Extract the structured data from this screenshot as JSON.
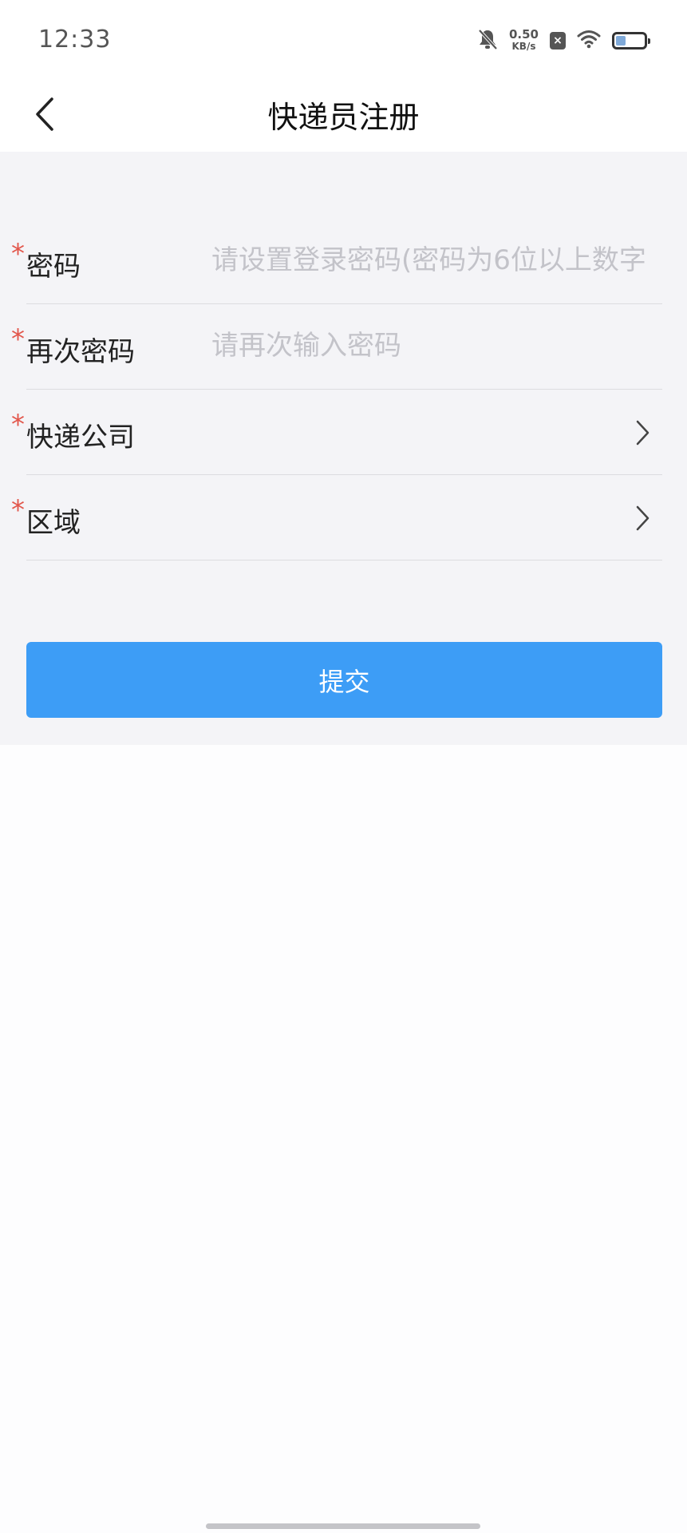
{
  "status_bar": {
    "time": "12:33",
    "net_speed_value": "0.50",
    "net_speed_unit": "KB/s",
    "icons": [
      "bell-off-icon",
      "close-badge-icon",
      "wifi-icon",
      "battery-icon"
    ],
    "battery_level": 0.35
  },
  "header": {
    "back_icon": "chevron-left-icon",
    "title": "快递员注册"
  },
  "form": {
    "required_mark": "*",
    "password": {
      "label": "密码",
      "value": "",
      "placeholder": "请设置登录密码(密码为6位以上数字"
    },
    "confirm_password": {
      "label": "再次密码",
      "value": "",
      "placeholder": "请再次输入密码"
    },
    "company": {
      "label": "快递公司",
      "value": "",
      "icon": "chevron-right-icon"
    },
    "region": {
      "label": "区域",
      "value": "",
      "icon": "chevron-right-icon"
    },
    "submit_label": "提交"
  },
  "colors": {
    "accent": "#3d9df6",
    "required": "#e2574c",
    "panel_bg": "#f4f4f7",
    "placeholder": "#c3c3c9"
  }
}
